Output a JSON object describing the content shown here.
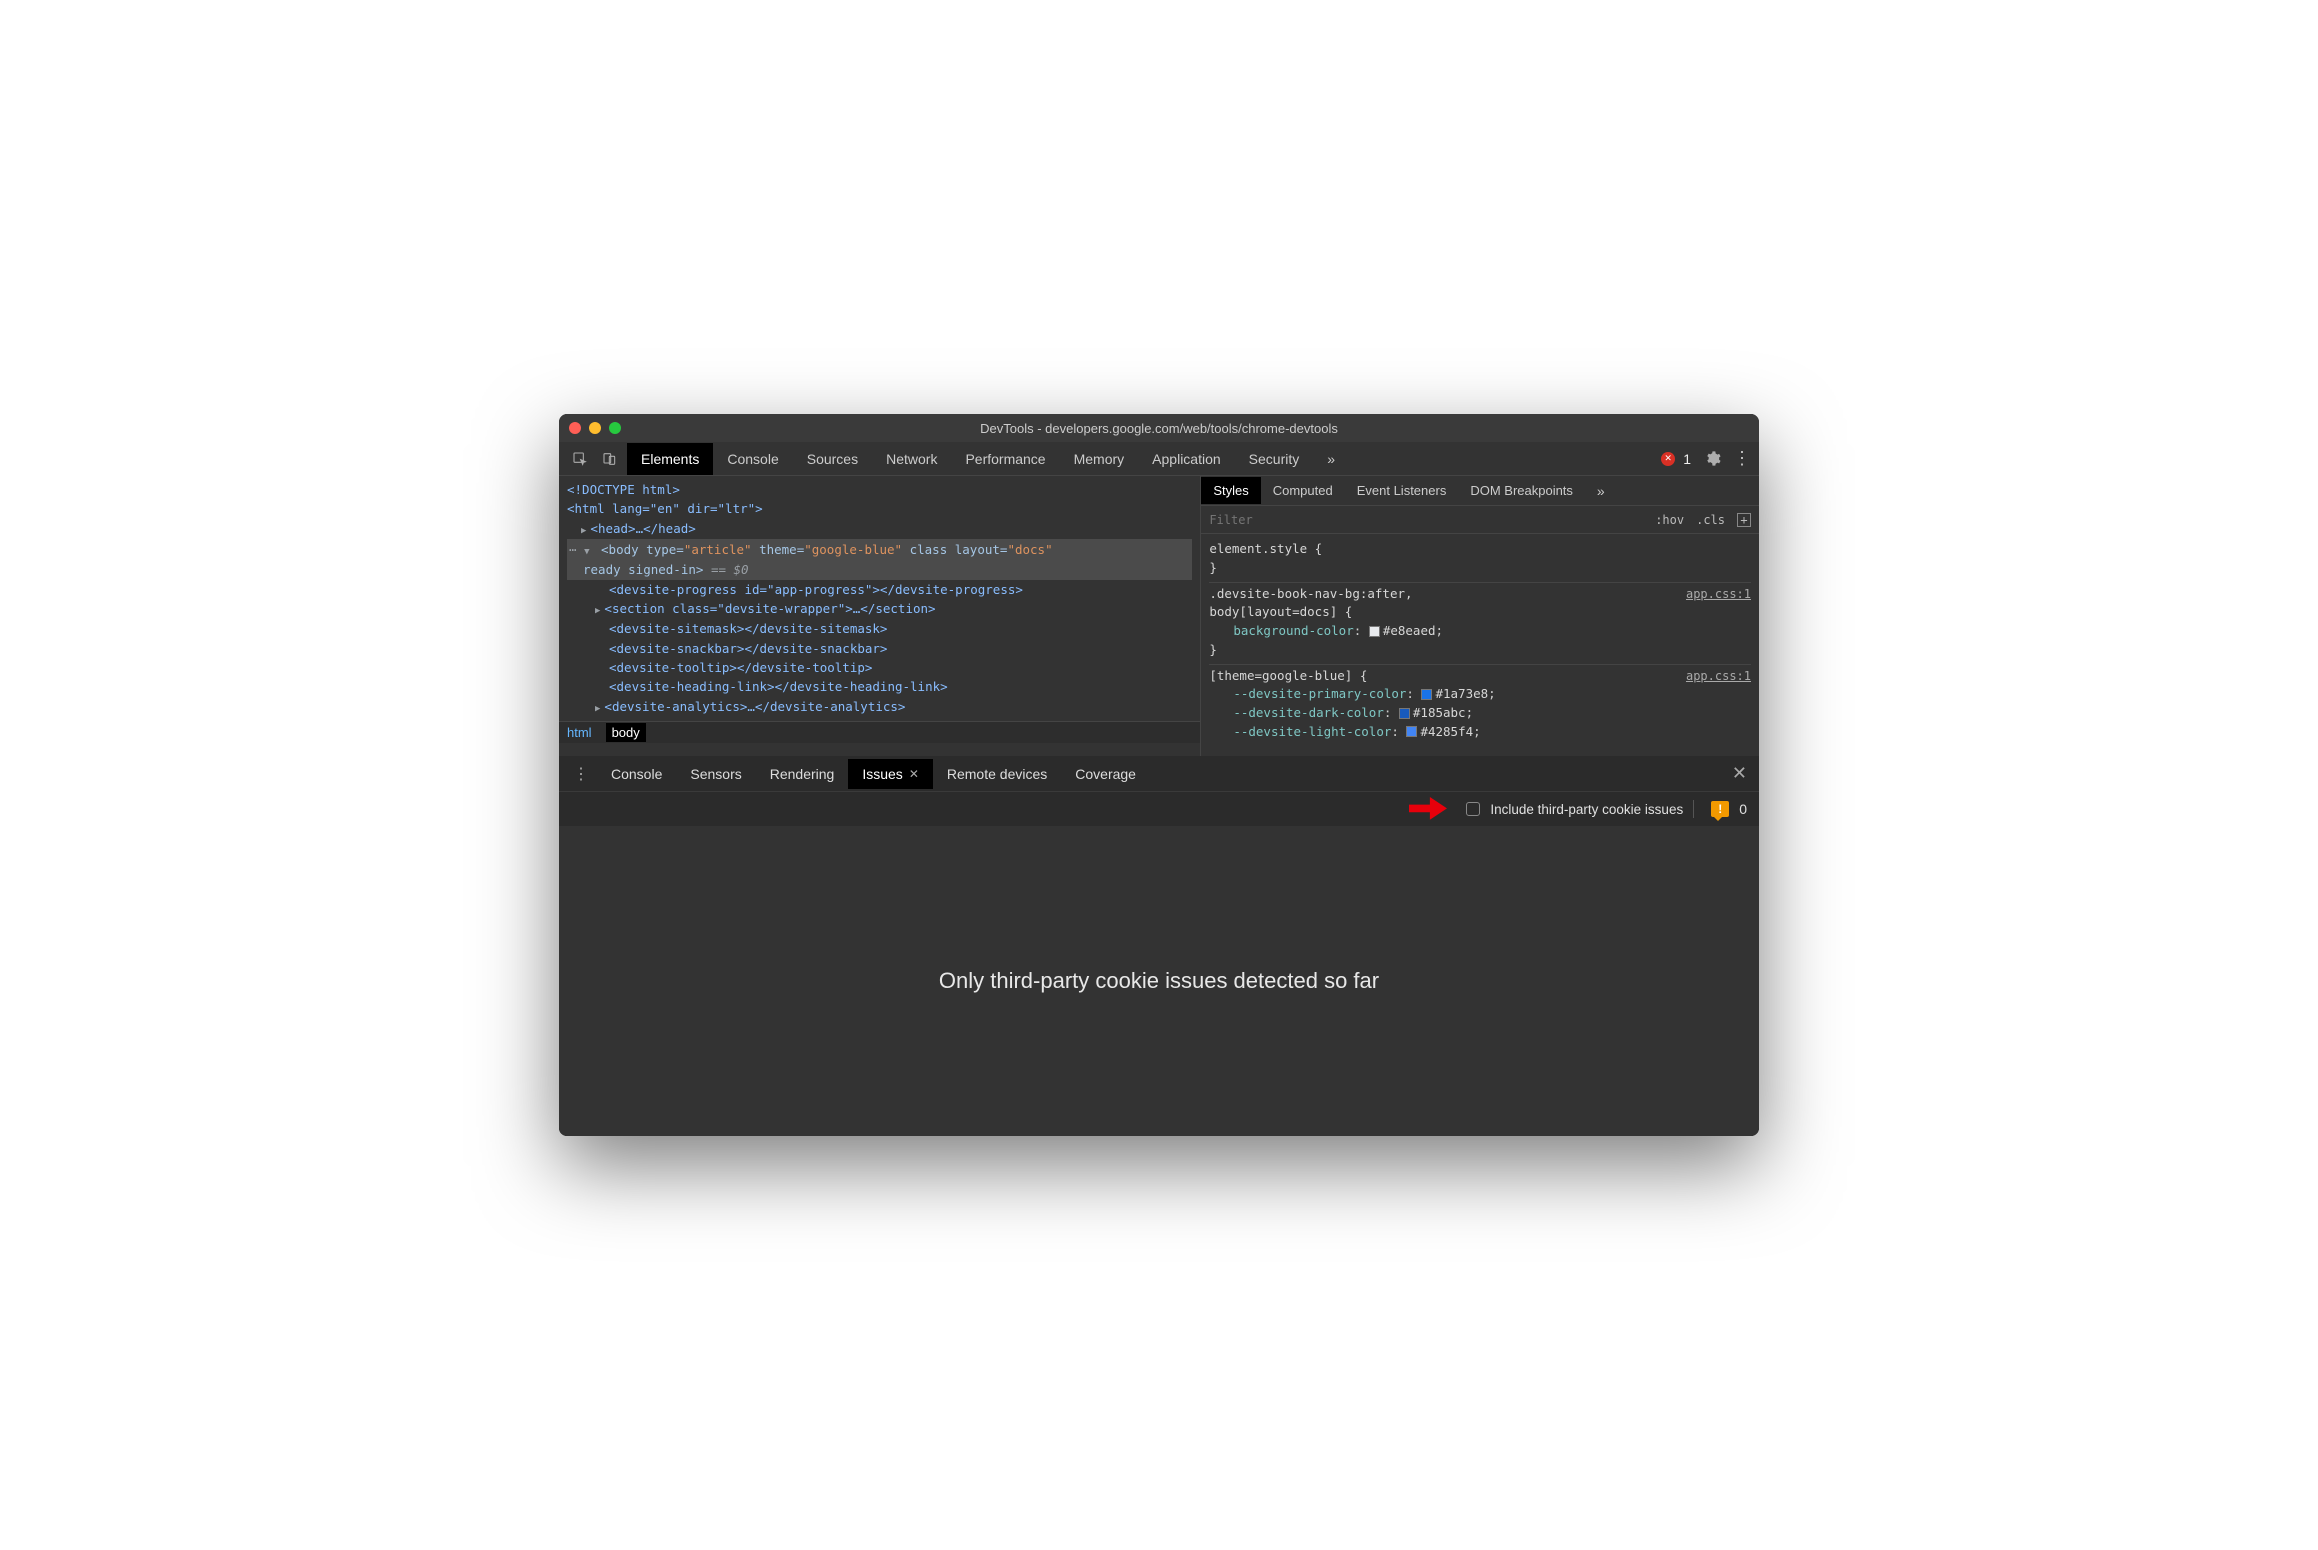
{
  "window": {
    "title": "DevTools - developers.google.com/web/tools/chrome-devtools"
  },
  "toolbar": {
    "tabs": [
      "Elements",
      "Console",
      "Sources",
      "Network",
      "Performance",
      "Memory",
      "Application",
      "Security"
    ],
    "error_count": "1",
    "more": "»"
  },
  "dom": {
    "doctype": "<!DOCTYPE html>",
    "html_open": "<html lang=\"en\" dir=\"ltr\">",
    "head": "<head>…</head>",
    "body_open_pre": "<body type=",
    "body_type": "\"article\"",
    "body_theme_attr": " theme=",
    "body_theme": "\"google-blue\"",
    "body_class": " class layout=",
    "body_layout": "\"docs\"",
    "ready": "ready signed-in>",
    "eq0": " == $0",
    "l1": "<devsite-progress id=\"app-progress\"></devsite-progress>",
    "l2": "<section class=\"devsite-wrapper\">…</section>",
    "l3": "<devsite-sitemask></devsite-sitemask>",
    "l4": "<devsite-snackbar></devsite-snackbar>",
    "l5": "<devsite-tooltip></devsite-tooltip>",
    "l6": "<devsite-heading-link></devsite-heading-link>",
    "l7": "<devsite-analytics>…</devsite-analytics>"
  },
  "breadcrumb": {
    "html": "html",
    "body": "body"
  },
  "styles": {
    "subtabs": [
      "Styles",
      "Computed",
      "Event Listeners",
      "DOM Breakpoints"
    ],
    "filter_placeholder": "Filter",
    "hov": ":hov",
    "cls": ".cls",
    "element_style": "element.style {",
    "close_brace": "}",
    "rule1_sel1": ".devsite-book-nav-bg:after,",
    "rule1_sel2": "body[layout=docs] {",
    "rule1_prop": "background-color",
    "rule1_val": "#e8eaed",
    "rule1_src": "app.css:1",
    "rule2_sel": "[theme=google-blue] {",
    "rule2_src": "app.css:1",
    "rule2_p1": "--devsite-primary-color",
    "rule2_v1": "#1a73e8",
    "rule2_p2": "--devsite-dark-color",
    "rule2_v2": "#185abc",
    "rule2_p3": "--devsite-light-color",
    "rule2_v3": "#4285f4",
    "more": "»"
  },
  "drawer": {
    "tabs": [
      "Console",
      "Sensors",
      "Rendering",
      "Issues",
      "Remote devices",
      "Coverage"
    ],
    "active_tab": "Issues",
    "checkbox_label": "Include third-party cookie issues",
    "warn_count": "0",
    "empty_msg": "Only third-party cookie issues detected so far"
  },
  "annotation": {
    "arrow_target": "include-third-party-checkbox"
  }
}
